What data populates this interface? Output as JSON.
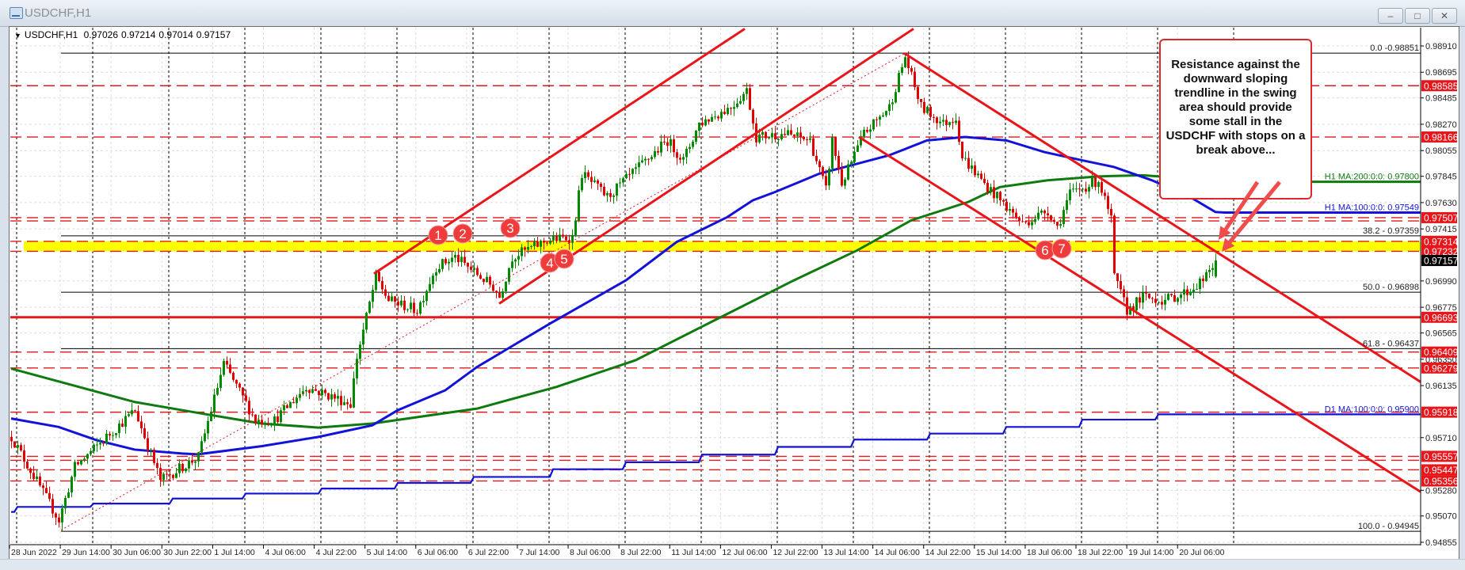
{
  "window": {
    "title": "USDCHF,H1",
    "icons": {
      "app": "chart-window-icon",
      "minimize": "minimize-icon",
      "maximize": "maximize-icon",
      "close": "close-icon"
    },
    "buttons": {
      "minimize": "–",
      "maximize": "□",
      "close": "✕"
    }
  },
  "chart_header": {
    "arrow": "▼",
    "symbol": "USDCHF,H1",
    "open": "0.97026",
    "high": "0.97214",
    "low": "0.97014",
    "close": "0.97157"
  },
  "annotation": {
    "lines": [
      "Resistance against the",
      "downward sloping",
      "trendline in the swing",
      "area should provide",
      "some stall in the",
      "USDCHF with stops on a",
      "break above..."
    ]
  },
  "chart_data": {
    "type": "candlestick",
    "symbol": "USDCHF",
    "timeframe": "H1",
    "ylim": [
      0.94855,
      0.9891
    ],
    "bars_shown": 381,
    "x_tick_labels": [
      "28 Jun 2022",
      "29 Jun 14:00",
      "30 Jun 06:00",
      "30 Jun 22:00",
      "1 Jul 14:00",
      "4 Jul 06:00",
      "4 Jul 22:00",
      "5 Jul 14:00",
      "6 Jul 06:00",
      "6 Jul 22:00",
      "7 Jul 14:00",
      "8 Jul 06:00",
      "8 Jul 22:00",
      "11 Jul 14:00",
      "12 Jul 06:00",
      "12 Jul 22:00",
      "13 Jul 14:00",
      "14 Jul 06:00",
      "14 Jul 22:00",
      "15 Jul 14:00",
      "18 Jul 06:00",
      "18 Jul 22:00",
      "19 Jul 14:00",
      "20 Jul 06:00"
    ],
    "x_tick_every_bars": 16,
    "y_tick_labels": [
      "0.98910",
      "0.98695",
      "0.98485",
      "0.98270",
      "0.98055",
      "0.97845",
      "0.97630",
      "0.97415",
      "0.96990",
      "0.96775",
      "0.96565",
      "0.96350",
      "0.96135",
      "0.95710",
      "0.95280",
      "0.95070",
      "0.94855"
    ],
    "close_path": [
      [
        0,
        0.95716
      ],
      [
        15,
        0.95035
      ],
      [
        20,
        0.95471
      ],
      [
        39,
        0.95934
      ],
      [
        47,
        0.95362
      ],
      [
        59,
        0.95552
      ],
      [
        67,
        0.96315
      ],
      [
        77,
        0.95852
      ],
      [
        83,
        0.95852
      ],
      [
        93,
        0.96124
      ],
      [
        107,
        0.95988
      ],
      [
        109,
        0.96369
      ],
      [
        115,
        0.97022
      ],
      [
        119,
        0.96832
      ],
      [
        128,
        0.9675
      ],
      [
        134,
        0.97104
      ],
      [
        140,
        0.97186
      ],
      [
        152,
        0.96941
      ],
      [
        154,
        0.96859
      ],
      [
        158,
        0.97186
      ],
      [
        169,
        0.97322
      ],
      [
        177,
        0.97349
      ],
      [
        180,
        0.97866
      ],
      [
        188,
        0.97676
      ],
      [
        197,
        0.97893
      ],
      [
        207,
        0.98138
      ],
      [
        212,
        0.97975
      ],
      [
        217,
        0.98275
      ],
      [
        227,
        0.98411
      ],
      [
        232,
        0.98547
      ],
      [
        235,
        0.98166
      ],
      [
        244,
        0.98193
      ],
      [
        252,
        0.98138
      ],
      [
        257,
        0.9773
      ],
      [
        259,
        0.98138
      ],
      [
        262,
        0.97784
      ],
      [
        269,
        0.98193
      ],
      [
        277,
        0.98411
      ],
      [
        282,
        0.98819
      ],
      [
        287,
        0.98411
      ],
      [
        294,
        0.98275
      ],
      [
        298,
        0.98329
      ],
      [
        300,
        0.98002
      ],
      [
        307,
        0.97784
      ],
      [
        314,
        0.97594
      ],
      [
        319,
        0.97458
      ],
      [
        327,
        0.97567
      ],
      [
        330,
        0.97431
      ],
      [
        334,
        0.97703
      ],
      [
        343,
        0.97812
      ],
      [
        347,
        0.97485
      ],
      [
        348,
        0.97022
      ],
      [
        352,
        0.9675
      ],
      [
        357,
        0.96859
      ],
      [
        364,
        0.96832
      ],
      [
        372,
        0.96913
      ],
      [
        377,
        0.97022
      ],
      [
        380,
        0.97157
      ]
    ],
    "period_high": {
      "bar": 282,
      "price": 0.98851
    },
    "period_low": {
      "bar": 16,
      "price": 0.94945
    },
    "last_candle": {
      "open": 0.97026,
      "high": 0.97214,
      "low": 0.97014,
      "close": 0.97157
    },
    "current_price_tag": "0.97157",
    "price_tags": [
      "0.98585",
      "0.98166",
      "0.97507",
      "0.97314",
      "0.97232",
      "0.96693",
      "0.96409",
      "0.96279",
      "0.95918",
      "0.95557",
      "0.95447",
      "0.95356"
    ],
    "dashed_levels": [
      0.98585,
      0.98166,
      0.97507,
      0.9748,
      0.97314,
      0.97232,
      0.96409,
      0.96279,
      0.95918,
      0.95557,
      0.95525,
      0.95447,
      0.95356
    ],
    "solid_level": 0.96693,
    "highlight_zone": [
      0.97232,
      0.97314
    ],
    "fibonacci": [
      {
        "label": "0.0 -0.98851",
        "price": 0.98851
      },
      {
        "label": "38.2 - 0.97359",
        "price": 0.97359
      },
      {
        "label": "50.0 - 0.96898",
        "price": 0.96898
      },
      {
        "label": "61.8 - 0.96437",
        "price": 0.96437
      },
      {
        "label": "100.0 - 0.94945",
        "price": 0.94945
      }
    ],
    "fib_start_bar": 15.75,
    "moving_averages": [
      {
        "label": "H1 MA:200:0:0: 0.97800",
        "color": "#0f7a0f",
        "points": [
          [
            0,
            0.96274
          ],
          [
            39,
            0.96001
          ],
          [
            59,
            0.95912
          ],
          [
            79,
            0.95825
          ],
          [
            97,
            0.95792
          ],
          [
            114,
            0.95825
          ],
          [
            147,
            0.95947
          ],
          [
            172,
            0.96124
          ],
          [
            197,
            0.96342
          ],
          [
            222,
            0.96669
          ],
          [
            247,
            0.96995
          ],
          [
            267,
            0.9724
          ],
          [
            284,
            0.97485
          ],
          [
            302,
            0.97635
          ],
          [
            312,
            0.97757
          ],
          [
            327,
            0.97812
          ],
          [
            343,
            0.97844
          ],
          [
            357,
            0.97853
          ],
          [
            372,
            0.97825
          ],
          [
            397,
            0.978
          ],
          [
            445,
            0.978
          ]
        ]
      },
      {
        "label": "H1 MA:100:0:0: 0.97549",
        "color": "#1212d8",
        "points": [
          [
            0,
            0.95866
          ],
          [
            15,
            0.95797
          ],
          [
            27,
            0.95689
          ],
          [
            39,
            0.95612
          ],
          [
            54,
            0.9558
          ],
          [
            59,
            0.95574
          ],
          [
            79,
            0.9564
          ],
          [
            97,
            0.95716
          ],
          [
            114,
            0.95811
          ],
          [
            122,
            0.95934
          ],
          [
            137,
            0.96097
          ],
          [
            147,
            0.96287
          ],
          [
            170,
            0.96641
          ],
          [
            194,
            0.96995
          ],
          [
            210,
            0.97308
          ],
          [
            226,
            0.97512
          ],
          [
            234,
            0.97648
          ],
          [
            241,
            0.97716
          ],
          [
            255,
            0.97866
          ],
          [
            269,
            0.97961
          ],
          [
            277,
            0.98016
          ],
          [
            289,
            0.98138
          ],
          [
            301,
            0.98166
          ],
          [
            314,
            0.98138
          ],
          [
            326,
            0.98043
          ],
          [
            338,
            0.97975
          ],
          [
            348,
            0.97921
          ],
          [
            360,
            0.97812
          ],
          [
            372,
            0.97676
          ],
          [
            380,
            0.97553
          ],
          [
            383,
            0.97549
          ],
          [
            445,
            0.97549
          ]
        ]
      },
      {
        "label": "D1 MA:100:0:0: 0.95900",
        "color": "#1212d8",
        "steps": [
          [
            0,
            0.95103
          ],
          [
            1,
            0.95144
          ],
          [
            25,
            0.95171
          ],
          [
            50,
            0.95212
          ],
          [
            73,
            0.95253
          ],
          [
            97,
            0.95294
          ],
          [
            121,
            0.9534
          ],
          [
            145,
            0.95389
          ],
          [
            170,
            0.95452
          ],
          [
            193,
            0.95509
          ],
          [
            217,
            0.95571
          ],
          [
            241,
            0.95634
          ],
          [
            265,
            0.95694
          ],
          [
            289,
            0.95743
          ],
          [
            313,
            0.95797
          ],
          [
            337,
            0.95857
          ],
          [
            361,
            0.959
          ]
        ]
      }
    ],
    "trendlines": [
      {
        "name": "rising-channel-upper",
        "from": [
          114.5,
          0.9705
        ],
        "to": [
          231.5,
          0.9905
        ]
      },
      {
        "name": "rising-channel-lower",
        "from": [
          154,
          0.96805
        ],
        "to": [
          284.75,
          0.9905
        ]
      },
      {
        "name": "swing-low-to-high-dotted",
        "from": [
          15.75,
          0.94954
        ],
        "to": [
          281.75,
          0.98846
        ],
        "dotted": true
      },
      {
        "name": "descending-trendline-upper",
        "from": [
          281.75,
          0.98851
        ],
        "to": [
          444.75,
          0.96165
        ]
      },
      {
        "name": "descending-trendline-lower",
        "from": [
          267.5,
          0.98166
        ],
        "to": [
          444.75,
          0.95267
        ]
      }
    ],
    "markers": [
      {
        "label": "1",
        "bar": 134.75,
        "price": 0.97364
      },
      {
        "label": "2",
        "bar": 142.5,
        "price": 0.97377
      },
      {
        "label": "3",
        "bar": 157.5,
        "price": 0.97422
      },
      {
        "label": "4",
        "bar": 170,
        "price": 0.97138
      },
      {
        "label": "5",
        "bar": 174.5,
        "price": 0.9717
      },
      {
        "label": "6",
        "bar": 326.25,
        "price": 0.97241
      },
      {
        "label": "7",
        "bar": 331.5,
        "price": 0.97254
      }
    ],
    "callout_target": {
      "bar": 381,
      "price": 0.97232
    },
    "colors": {
      "up": "#008a00",
      "down": "#e00000",
      "level": "#e0191b",
      "zone": "#ffff00",
      "arrow": "#f04c4c",
      "grid": "#dcdcdc"
    }
  }
}
